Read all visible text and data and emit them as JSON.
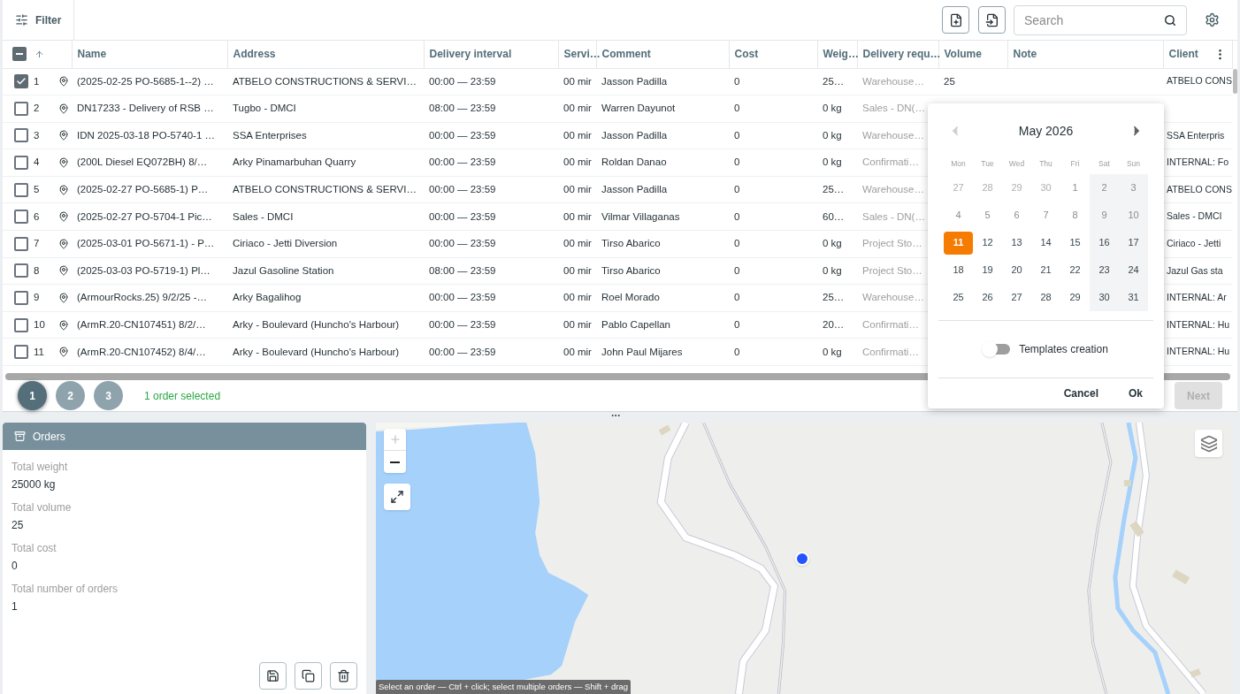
{
  "toolbar": {
    "filter_label": "Filter",
    "search": {
      "placeholder": "Search"
    }
  },
  "table": {
    "select_all_partial": true,
    "columns": [
      "Name",
      "Address",
      "Delivery interval",
      "Servi…",
      "Comment",
      "Cost",
      "Weig…",
      "Delivery requ…",
      "Volume",
      "Note",
      "Client"
    ],
    "rows": [
      {
        "number": "1",
        "checked": true,
        "name": "(2025-02-25 PO-5685-1--2) …",
        "address": "ATBELO CONSTRUCTIONS & SERVI…",
        "interval": "00:00 — 23:59",
        "service": "00 mir",
        "comment": "Jasson Padilla",
        "cost": "0",
        "weight": "25…",
        "requirement": "Warehouse…",
        "volume": "25",
        "client": "ATBELO CONS"
      },
      {
        "number": "2",
        "checked": false,
        "name": "DN17233 - Delivery of RSB …",
        "address": "Tugbo - DMCI",
        "interval": "08:00 — 23:59",
        "service": "00 mir",
        "comment": "Warren Dayunot",
        "cost": "0",
        "weight": "0 kg",
        "requirement": "Sales - DN(…"
      },
      {
        "number": "3",
        "checked": false,
        "name": "IDN 2025-03-18 PO-5740-1 …",
        "address": "SSA Enterprises",
        "interval": "00:00 — 23:59",
        "service": "00 mir",
        "comment": "Jasson Padilla",
        "cost": "0",
        "weight": "0 kg",
        "requirement": "Warehouse…",
        "client": "SSA Enterpris"
      },
      {
        "number": "4",
        "checked": false,
        "name": "(200L Diesel EQ072BH) 8/…",
        "address": "Arky Pinamarbuhan Quarry",
        "interval": "00:00 — 23:59",
        "service": "00 mir",
        "comment": "Roldan Danao",
        "cost": "0",
        "weight": "0 kg",
        "requirement": "Confirmati…",
        "client": "INTERNAL: Fo"
      },
      {
        "number": "5",
        "checked": false,
        "name": "(2025-02-27 PO-5685-1) P…",
        "address": "ATBELO CONSTRUCTIONS & SERVI…",
        "interval": "00:00 — 23:59",
        "service": "00 mir",
        "comment": "Jasson Padilla",
        "cost": "0",
        "weight": "25…",
        "requirement": "Warehouse…",
        "client": "ATBELO CONS"
      },
      {
        "number": "6",
        "checked": false,
        "name": "(2025-02-27 PO-5704-1 Pic…",
        "address": "Sales - DMCI",
        "interval": "00:00 — 23:59",
        "service": "00 mir",
        "comment": "Vilmar Villaganas",
        "cost": "0",
        "weight": "60…",
        "requirement": "Sales - DN(…",
        "client": "Sales - DMCI"
      },
      {
        "number": "7",
        "checked": false,
        "name": "(2025-03-01 PO-5671-1) - P…",
        "address": "Ciriaco - Jetti Diversion",
        "interval": "00:00 — 23:59",
        "service": "00 mir",
        "comment": "Tirso Abarico",
        "cost": "0",
        "weight": "0 kg",
        "requirement": "Project Sto…",
        "client": "Ciriaco - Jetti"
      },
      {
        "number": "8",
        "checked": false,
        "name": "(2025-03-03 PO-5719-1) Pl…",
        "address": "Jazul Gasoline Station",
        "interval": "08:00 — 23:59",
        "service": "00 mir",
        "comment": "Tirso Abarico",
        "cost": "0",
        "weight": "0 kg",
        "requirement": "Project Sto…",
        "client": "Jazul Gas sta"
      },
      {
        "number": "9",
        "checked": false,
        "name": "(ArmourRocks.25) 9/2/25 -…",
        "address": "Arky Bagalihog",
        "interval": "00:00 — 23:59",
        "service": "00 mir",
        "comment": "Roel Morado",
        "cost": "0",
        "weight": "25…",
        "requirement": "Warehouse…",
        "client": "INTERNAL: Ar"
      },
      {
        "number": "10",
        "checked": false,
        "name": "(ArmR.20-CN107451) 8/2/…",
        "address": "Arky - Boulevard (Huncho's Harbour)",
        "interval": "00:00 — 23:59",
        "service": "00 mir",
        "comment": "Pablo Capellan",
        "cost": "0",
        "weight": "20…",
        "requirement": "Confirmati…",
        "client": "INTERNAL: Hu"
      },
      {
        "number": "11",
        "checked": false,
        "name": "(ArmR.20-CN107452) 8/4/…",
        "address": "Arky - Boulevard (Huncho's Harbour)",
        "interval": "00:00 — 23:59",
        "service": "00 mir",
        "comment": "John Paul Mijares",
        "cost": "0",
        "weight": "0 kg",
        "requirement": "Confirmati…",
        "client": "INTERNAL: Hu"
      }
    ]
  },
  "pager": {
    "steps": [
      {
        "label": "1",
        "selected": true
      },
      {
        "label": "2",
        "selected": false
      },
      {
        "label": "3",
        "selected": false
      }
    ],
    "status": "1 order selected",
    "next": {
      "label": "Next",
      "disabled": true
    }
  },
  "calendar": {
    "month": "May 2026",
    "prev_disabled": true,
    "next_disabled": false,
    "weekdays": [
      "Mon",
      "Tue",
      "Wed",
      "Thu",
      "Fri",
      "Sat",
      "Sun"
    ],
    "weeks": [
      [
        {
          "label": "27",
          "outside_month": true,
          "disabled": true,
          "selected": false
        },
        {
          "label": "28",
          "outside_month": true,
          "disabled": true,
          "selected": false
        },
        {
          "label": "29",
          "outside_month": true,
          "disabled": true,
          "selected": false
        },
        {
          "label": "30",
          "outside_month": true,
          "disabled": true,
          "selected": false
        },
        {
          "label": "1",
          "outside_month": false,
          "disabled": true,
          "selected": false
        },
        {
          "label": "2",
          "outside_month": false,
          "disabled": true,
          "selected": false
        },
        {
          "label": "3",
          "outside_month": false,
          "disabled": true,
          "selected": false
        }
      ],
      [
        {
          "label": "4",
          "outside_month": false,
          "disabled": true,
          "selected": false
        },
        {
          "label": "5",
          "outside_month": false,
          "disabled": true,
          "selected": false
        },
        {
          "label": "6",
          "outside_month": false,
          "disabled": true,
          "selected": false
        },
        {
          "label": "7",
          "outside_month": false,
          "disabled": true,
          "selected": false
        },
        {
          "label": "8",
          "outside_month": false,
          "disabled": true,
          "selected": false
        },
        {
          "label": "9",
          "outside_month": false,
          "disabled": true,
          "selected": false
        },
        {
          "label": "10",
          "outside_month": false,
          "disabled": true,
          "selected": false
        }
      ],
      [
        {
          "label": "11",
          "outside_month": false,
          "disabled": false,
          "selected": true
        },
        {
          "label": "12",
          "outside_month": false,
          "disabled": false,
          "selected": false
        },
        {
          "label": "13",
          "outside_month": false,
          "disabled": false,
          "selected": false
        },
        {
          "label": "14",
          "outside_month": false,
          "disabled": false,
          "selected": false
        },
        {
          "label": "15",
          "outside_month": false,
          "disabled": false,
          "selected": false
        },
        {
          "label": "16",
          "outside_month": false,
          "disabled": false,
          "selected": false
        },
        {
          "label": "17",
          "outside_month": false,
          "disabled": false,
          "selected": false
        }
      ],
      [
        {
          "label": "18",
          "outside_month": false,
          "disabled": false,
          "selected": false
        },
        {
          "label": "19",
          "outside_month": false,
          "disabled": false,
          "selected": false
        },
        {
          "label": "20",
          "outside_month": false,
          "disabled": false,
          "selected": false
        },
        {
          "label": "21",
          "outside_month": false,
          "disabled": false,
          "selected": false
        },
        {
          "label": "22",
          "outside_month": false,
          "disabled": false,
          "selected": false
        },
        {
          "label": "23",
          "outside_month": false,
          "disabled": false,
          "selected": false
        },
        {
          "label": "24",
          "outside_month": false,
          "disabled": false,
          "selected": false
        }
      ],
      [
        {
          "label": "25",
          "outside_month": false,
          "disabled": false,
          "selected": false
        },
        {
          "label": "26",
          "outside_month": false,
          "disabled": false,
          "selected": false
        },
        {
          "label": "27",
          "outside_month": false,
          "disabled": false,
          "selected": false
        },
        {
          "label": "28",
          "outside_month": false,
          "disabled": false,
          "selected": false
        },
        {
          "label": "29",
          "outside_month": false,
          "disabled": false,
          "selected": false
        },
        {
          "label": "30",
          "outside_month": false,
          "disabled": false,
          "selected": false
        },
        {
          "label": "31",
          "outside_month": false,
          "disabled": false,
          "selected": false
        }
      ]
    ],
    "templates_toggle": {
      "label": "Templates creation",
      "on": false
    },
    "buttons": [
      "Cancel",
      "Ok"
    ]
  },
  "orders_panel": {
    "title": "Orders",
    "stats": [
      {
        "label": "Total weight",
        "value": "25000 kg"
      },
      {
        "label": "Total volume",
        "value": "25"
      },
      {
        "label": "Total cost",
        "value": "0"
      },
      {
        "label": "Total number of orders",
        "value": "1"
      }
    ]
  },
  "map": {
    "zoom_in_disabled": true,
    "hint": "Select an order — Ctrl + click; select multiple orders — Shift + drag"
  }
}
